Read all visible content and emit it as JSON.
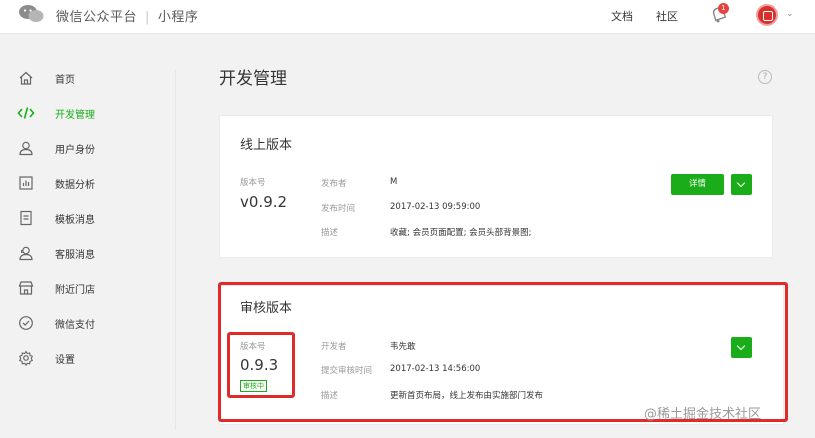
{
  "header": {
    "brand_name": "微信公众平台",
    "separator": "|",
    "product_name": "小程序",
    "docs_link": "文档",
    "community_link": "社区",
    "notification_count": "1"
  },
  "sidebar": {
    "items": [
      {
        "label": "首页",
        "icon": "home-icon"
      },
      {
        "label": "开发管理",
        "icon": "code-icon"
      },
      {
        "label": "用户身份",
        "icon": "user-icon"
      },
      {
        "label": "数据分析",
        "icon": "chart-icon"
      },
      {
        "label": "模板消息",
        "icon": "template-icon"
      },
      {
        "label": "客服消息",
        "icon": "support-icon"
      },
      {
        "label": "附近门店",
        "icon": "store-icon"
      },
      {
        "label": "微信支付",
        "icon": "pay-icon"
      },
      {
        "label": "设置",
        "icon": "settings-icon"
      }
    ],
    "active_index": 1
  },
  "main": {
    "page_title": "开发管理",
    "help_glyph": "?",
    "online": {
      "title": "线上版本",
      "version_label": "版本号",
      "version": "v0.9.2",
      "publisher_label": "发布者",
      "publisher": "M",
      "time_label": "发布时间",
      "time": "2017-02-13 09:59:00",
      "desc_label": "描述",
      "desc": "收藏; 会员页面配置; 会员头部背景图;",
      "details_button": "详情"
    },
    "review": {
      "title": "审核版本",
      "version_label": "版本号",
      "version": "0.9.3",
      "status": "审核中",
      "developer_label": "开发者",
      "developer": "韦先敢",
      "time_label": "提交审核时间",
      "time": "2017-02-13 14:56:00",
      "desc_label": "描述",
      "desc": "更新首页布局，线上发布由实施部门发布"
    }
  },
  "watermark": "@稀土掘金技术社区",
  "colors": {
    "accent": "#1aad19",
    "highlight": "#e02b2b",
    "badge": "#e64340"
  }
}
